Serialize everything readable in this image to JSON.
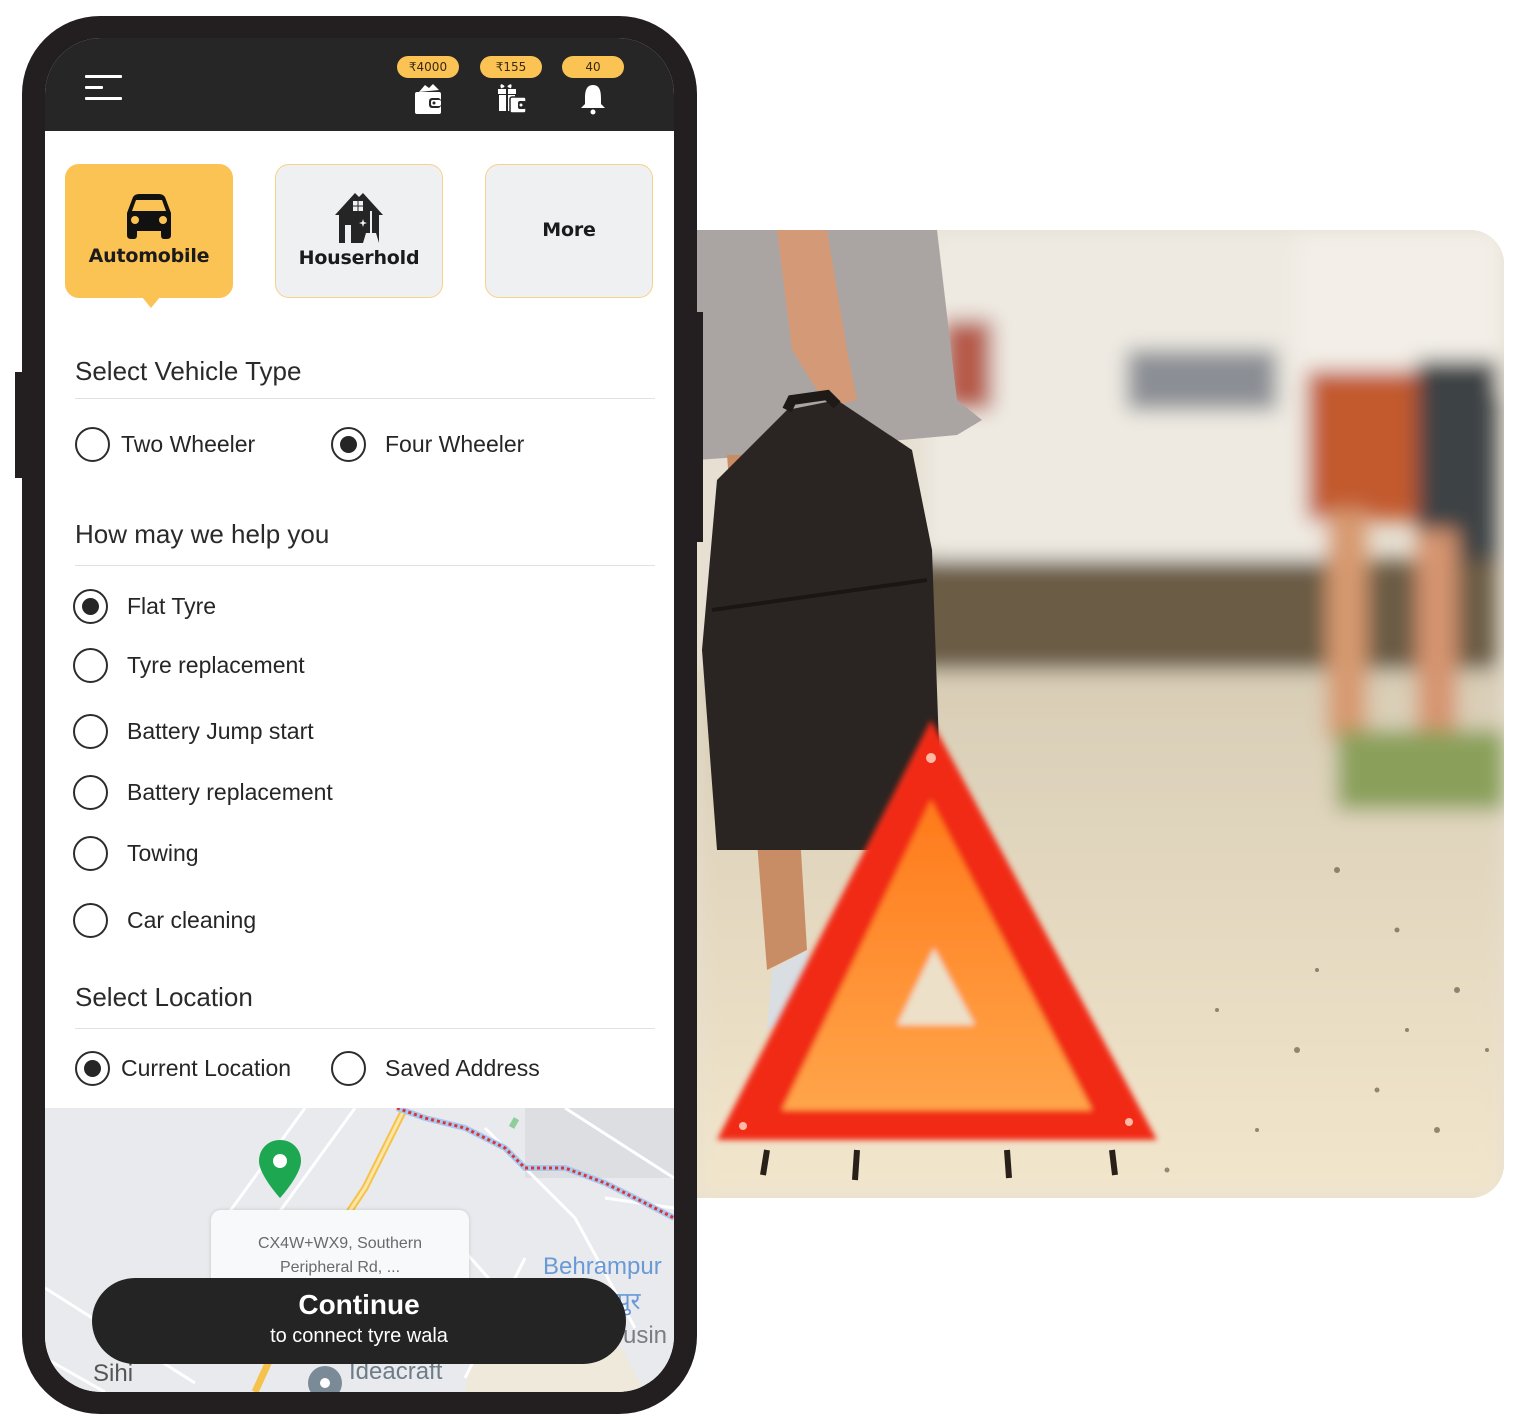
{
  "header": {
    "wallet_amount": "₹4000",
    "gift_amount": "₹155",
    "notification_count": "40",
    "icons": [
      "menu-icon",
      "wallet-icon",
      "gift-wallet-icon",
      "bell-icon"
    ]
  },
  "categories": [
    {
      "label": "Automobile",
      "icon": "car-icon",
      "active": true
    },
    {
      "label": "Houserhold",
      "icon": "house-cleaning-icon",
      "active": false
    },
    {
      "label": "More",
      "active": false
    }
  ],
  "vehicle": {
    "title": "Select Vehicle Type",
    "options": [
      {
        "label": "Two Wheeler",
        "checked": false
      },
      {
        "label": "Four Wheeler",
        "checked": true
      }
    ]
  },
  "help": {
    "title": "How may we help you",
    "options": [
      {
        "label": "Flat Tyre",
        "checked": true
      },
      {
        "label": "Tyre replacement",
        "checked": false
      },
      {
        "label": "Battery Jump start",
        "checked": false
      },
      {
        "label": "Battery replacement",
        "checked": false
      },
      {
        "label": "Towing",
        "checked": false
      },
      {
        "label": "Car cleaning",
        "checked": false
      }
    ]
  },
  "location": {
    "title": "Select Location",
    "options": [
      {
        "label": "Current Location",
        "checked": true
      },
      {
        "label": "Saved Address",
        "checked": false
      }
    ]
  },
  "map": {
    "address_line1": "CX4W+WX9, Southern",
    "address_line2": "Peripheral Rd, ...",
    "labels": {
      "behrampur": "Behrampur",
      "behrampur_hindi": "पुर",
      "housing": "usin",
      "sihi": "Sihi",
      "ideacraft": "Ideacraft"
    },
    "pin_color": "#1da750"
  },
  "continue": {
    "label": "Continue",
    "sublabel": "to connect tyre wala"
  },
  "colors": {
    "accent": "#fbc254",
    "dark": "#242424",
    "pin": "#1da750"
  },
  "photo": {
    "subject": "roadside-warning-triangle-photo"
  }
}
